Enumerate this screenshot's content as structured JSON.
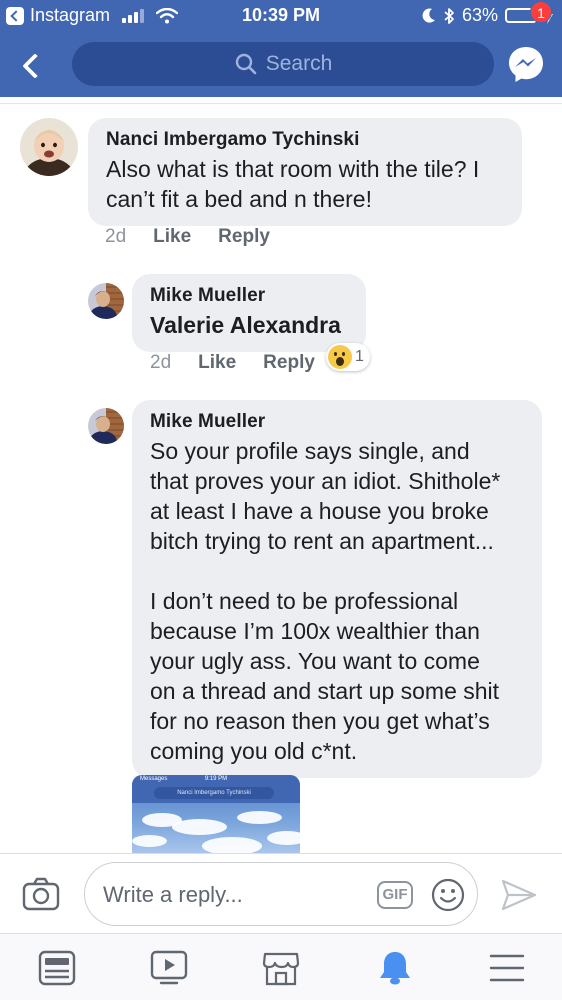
{
  "status_bar": {
    "back_app": "Instagram",
    "time": "10:39 PM",
    "battery": "63%",
    "battery_level": 0.63
  },
  "header": {
    "search_placeholder": "Search",
    "messenger_badge": "1",
    "colors": {
      "brand": "#4267b2",
      "search_field": "#2c4d94",
      "badge": "#fa3e3e"
    }
  },
  "comments": [
    {
      "author": "Nanci Imbergamo Tychinski",
      "text_lines": [
        "Also what is that room with the tile? I",
        "can’t fit a bed and n there!"
      ],
      "timestamp": "2d",
      "like_label": "Like",
      "reply_label": "Reply"
    },
    {
      "author": "Mike Mueller",
      "text_lines": [
        "Valerie Alexandra"
      ],
      "timestamp": "2d",
      "like_label": "Like",
      "reply_label": "Reply",
      "reaction": {
        "icon": "wow-reaction-icon",
        "count": "1"
      }
    },
    {
      "author": "Mike Mueller",
      "text_lines": [
        "So your profile says single, and",
        "that proves your an idiot. Shithole*",
        "at least I have a house you broke",
        "bitch trying to rent an apartment...",
        "",
        "I don’t need to be professional",
        "because I’m 100x wealthier than",
        "your ugly ass. You want to come",
        "on a thread and start up some shit",
        "for no reason then you get what’s",
        "coming you old c*nt."
      ]
    }
  ],
  "attachment": {
    "status_left": "Messages",
    "status_time": "9:19 PM",
    "search_text": "Nanci Imbergamo Tychinski"
  },
  "composer": {
    "placeholder": "Write a reply...",
    "gif_label": "GIF"
  },
  "tabbar": {
    "tabs": [
      "news-feed-icon",
      "watch-icon",
      "marketplace-icon",
      "notifications-icon",
      "menu-icon"
    ],
    "active": "notifications-icon"
  }
}
